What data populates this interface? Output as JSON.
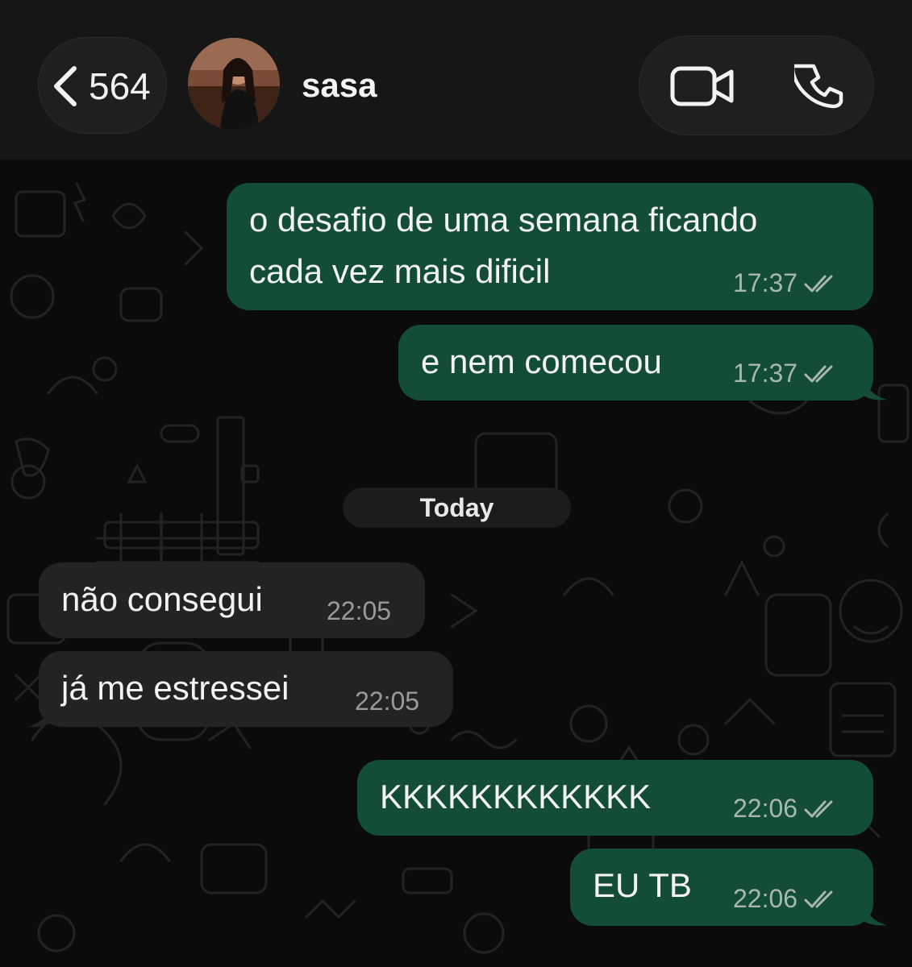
{
  "header": {
    "back_count": "564",
    "contact_name": "sasa"
  },
  "date_separator": "Today",
  "messages": [
    {
      "direction": "outgoing",
      "line1": "o desafio de uma semana ficando",
      "line2": "cada vez mais dificil",
      "time": "17:37",
      "status": "read"
    },
    {
      "direction": "outgoing",
      "text": "e nem comecou",
      "time": "17:37",
      "status": "read"
    },
    {
      "direction": "incoming",
      "text": "não consegui",
      "time": "22:05"
    },
    {
      "direction": "incoming",
      "text": "já me estressei",
      "time": "22:05"
    },
    {
      "direction": "outgoing",
      "text": "KKKKKKKKKKKK",
      "time": "22:06",
      "status": "read"
    },
    {
      "direction": "outgoing",
      "text": "EU TB",
      "time": "22:06",
      "status": "read"
    }
  ],
  "colors": {
    "outgoing_bubble": "#134d36",
    "incoming_bubble": "#232323",
    "background": "#0b0b0b",
    "header": "#161616"
  },
  "icons": [
    "chevron-left-icon",
    "video-camera-icon",
    "phone-icon",
    "double-check-icon"
  ]
}
